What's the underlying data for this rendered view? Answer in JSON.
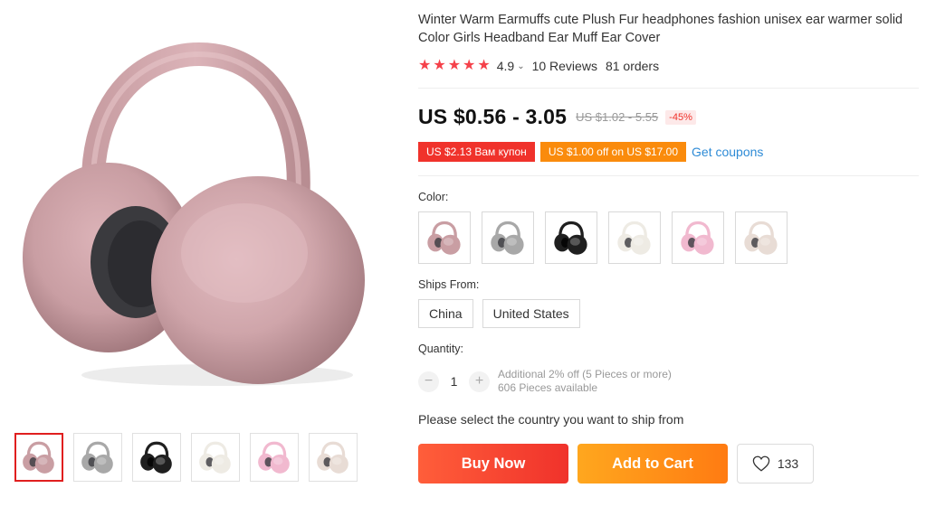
{
  "product": {
    "title": "Winter Warm Earmuffs cute Plush Fur headphones fashion unisex ear warmer solid Color Girls Headband Ear Muff Ear Cover",
    "main_image_icon": "pink-earmuff-image"
  },
  "gallery": {
    "thumbnails": [
      {
        "icon": "pink-earmuff-thumb",
        "color": "#c99ea3",
        "selected": true
      },
      {
        "icon": "gray-earmuff-thumb",
        "color": "#a8a8a8",
        "selected": false
      },
      {
        "icon": "black-earmuff-thumb",
        "color": "#1f1f1f",
        "selected": false
      },
      {
        "icon": "white-earmuff-thumb",
        "color": "#eeebe4",
        "selected": false
      },
      {
        "icon": "light-pink-earmuff-thumb",
        "color": "#f1b9cf",
        "selected": false
      },
      {
        "icon": "beige-earmuff-thumb",
        "color": "#e8dcd5",
        "selected": false
      }
    ]
  },
  "rating": {
    "stars": 5,
    "value": "4.9",
    "reviews": "10 Reviews",
    "orders": "81 orders"
  },
  "price": {
    "current": "US $0.56 - 3.05",
    "original": "US $1.02 - 5.55",
    "discount": "-45%"
  },
  "coupons": {
    "coupon1": "US $2.13 Вам купон",
    "coupon2": "US $1.00 off on US $17.00",
    "get_coupons": "Get coupons"
  },
  "color": {
    "label": "Color:",
    "options": [
      {
        "icon": "pink-earmuff-swatch",
        "color": "#c99ea3"
      },
      {
        "icon": "gray-earmuff-swatch",
        "color": "#a8a8a8"
      },
      {
        "icon": "black-earmuff-swatch",
        "color": "#1f1f1f"
      },
      {
        "icon": "white-earmuff-swatch",
        "color": "#eeebe4"
      },
      {
        "icon": "light-pink-earmuff-swatch",
        "color": "#f1b9cf"
      },
      {
        "icon": "beige-earmuff-swatch",
        "color": "#e8dcd5"
      }
    ]
  },
  "ships_from": {
    "label": "Ships From:",
    "options": [
      "China",
      "United States"
    ]
  },
  "quantity": {
    "label": "Quantity:",
    "minus": "−",
    "plus": "+",
    "value": "1",
    "additional": "Additional 2% off (5 Pieces or more)",
    "available": "606 Pieces available"
  },
  "shipping_note": "Please select the country you want to ship from",
  "actions": {
    "buy_now": "Buy Now",
    "add_to_cart": "Add to Cart",
    "wishlist_count": "133",
    "wishlist_icon": "heart-icon"
  },
  "colors": {
    "accent_red": "#f0322b",
    "accent_orange": "#fa8b0c",
    "link_blue": "#2e8bd6",
    "star": "#f5414a"
  }
}
